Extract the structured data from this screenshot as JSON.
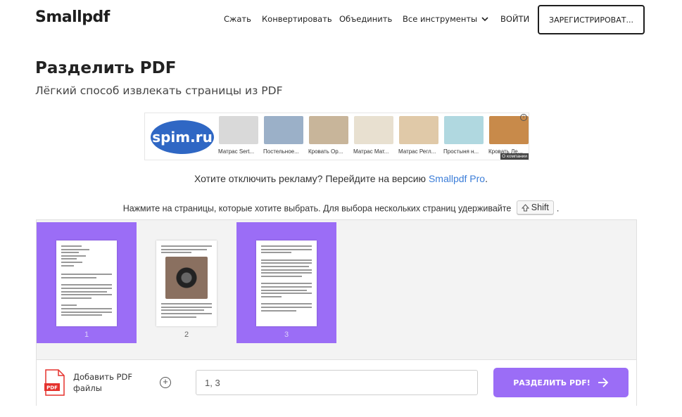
{
  "header": {
    "logo": "Smallpdf",
    "nav": [
      "Сжать",
      "Конвертировать",
      "Объединить",
      "Все инструменты"
    ],
    "login": "ВОЙТИ",
    "signup": "ЗАРЕГИСТРИРОВАТ..."
  },
  "page": {
    "title": "Разделить PDF",
    "subtitle": "Лёгкий способ извлекать страницы из PDF"
  },
  "ad": {
    "logo": "spim.ru",
    "items": [
      {
        "label": "Матрас Sert...",
        "color": "#d9d9d9"
      },
      {
        "label": "Постельное...",
        "color": "#9bb0c8"
      },
      {
        "label": "Кровать Ор...",
        "color": "#c8b59a"
      },
      {
        "label": "Матрас Мат...",
        "color": "#e8e0d0"
      },
      {
        "label": "Матрас Регл...",
        "color": "#e0c9a8"
      },
      {
        "label": "Простыня н...",
        "color": "#b0d8e0"
      },
      {
        "label": "Кровать Ле...",
        "color": "#c88a4a"
      }
    ],
    "badge": "i",
    "company": "О компании"
  },
  "upsell": {
    "text": "Хотите отключить рекламу? Перейдите на версию ",
    "link": "Smallpdf Pro",
    "suffix": "."
  },
  "instructions": {
    "text": "Нажмите на страницы, которые хотите выбрать. Для выбора нескольких страниц удерживайте",
    "key": "Shift",
    "suffix": "."
  },
  "pages": [
    {
      "number": "1",
      "selected": true
    },
    {
      "number": "2",
      "selected": false
    },
    {
      "number": "3",
      "selected": true
    }
  ],
  "footer": {
    "add_label": "Добавить PDF файлы",
    "range_value": "1, 3",
    "split_button": "РАЗДЕЛИТЬ PDF!"
  },
  "colors": {
    "accent": "#9b6df6",
    "link": "#3b7dd8",
    "pdf_red": "#e5322d"
  }
}
